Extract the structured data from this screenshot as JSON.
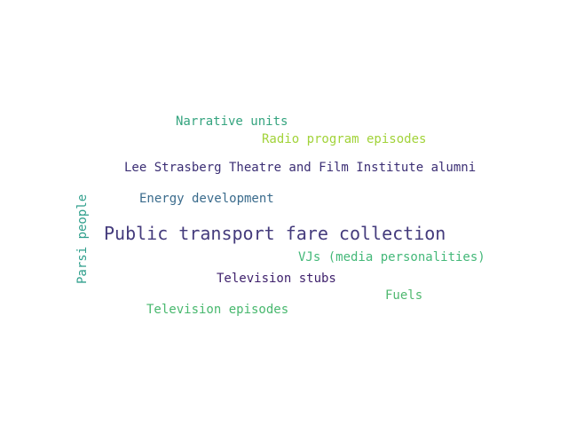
{
  "words": [
    {
      "text": "Narrative units",
      "color": "#35a47f"
    },
    {
      "text": "Radio program episodes",
      "color": "#a2d33a"
    },
    {
      "text": "Lee Strasberg Theatre and Film Institute alumni",
      "color": "#3b2e74"
    },
    {
      "text": "Energy development",
      "color": "#3a6b8c"
    },
    {
      "text": "Public transport fare collection",
      "color": "#443b7c"
    },
    {
      "text": "VJs (media personalities)",
      "color": "#44b879"
    },
    {
      "text": "Television stubs",
      "color": "#3d1f6b"
    },
    {
      "text": "Fuels",
      "color": "#4fb86f"
    },
    {
      "text": "Television episodes",
      "color": "#48b86e"
    },
    {
      "text": "Parsi people",
      "color": "#2f9f8c"
    }
  ]
}
